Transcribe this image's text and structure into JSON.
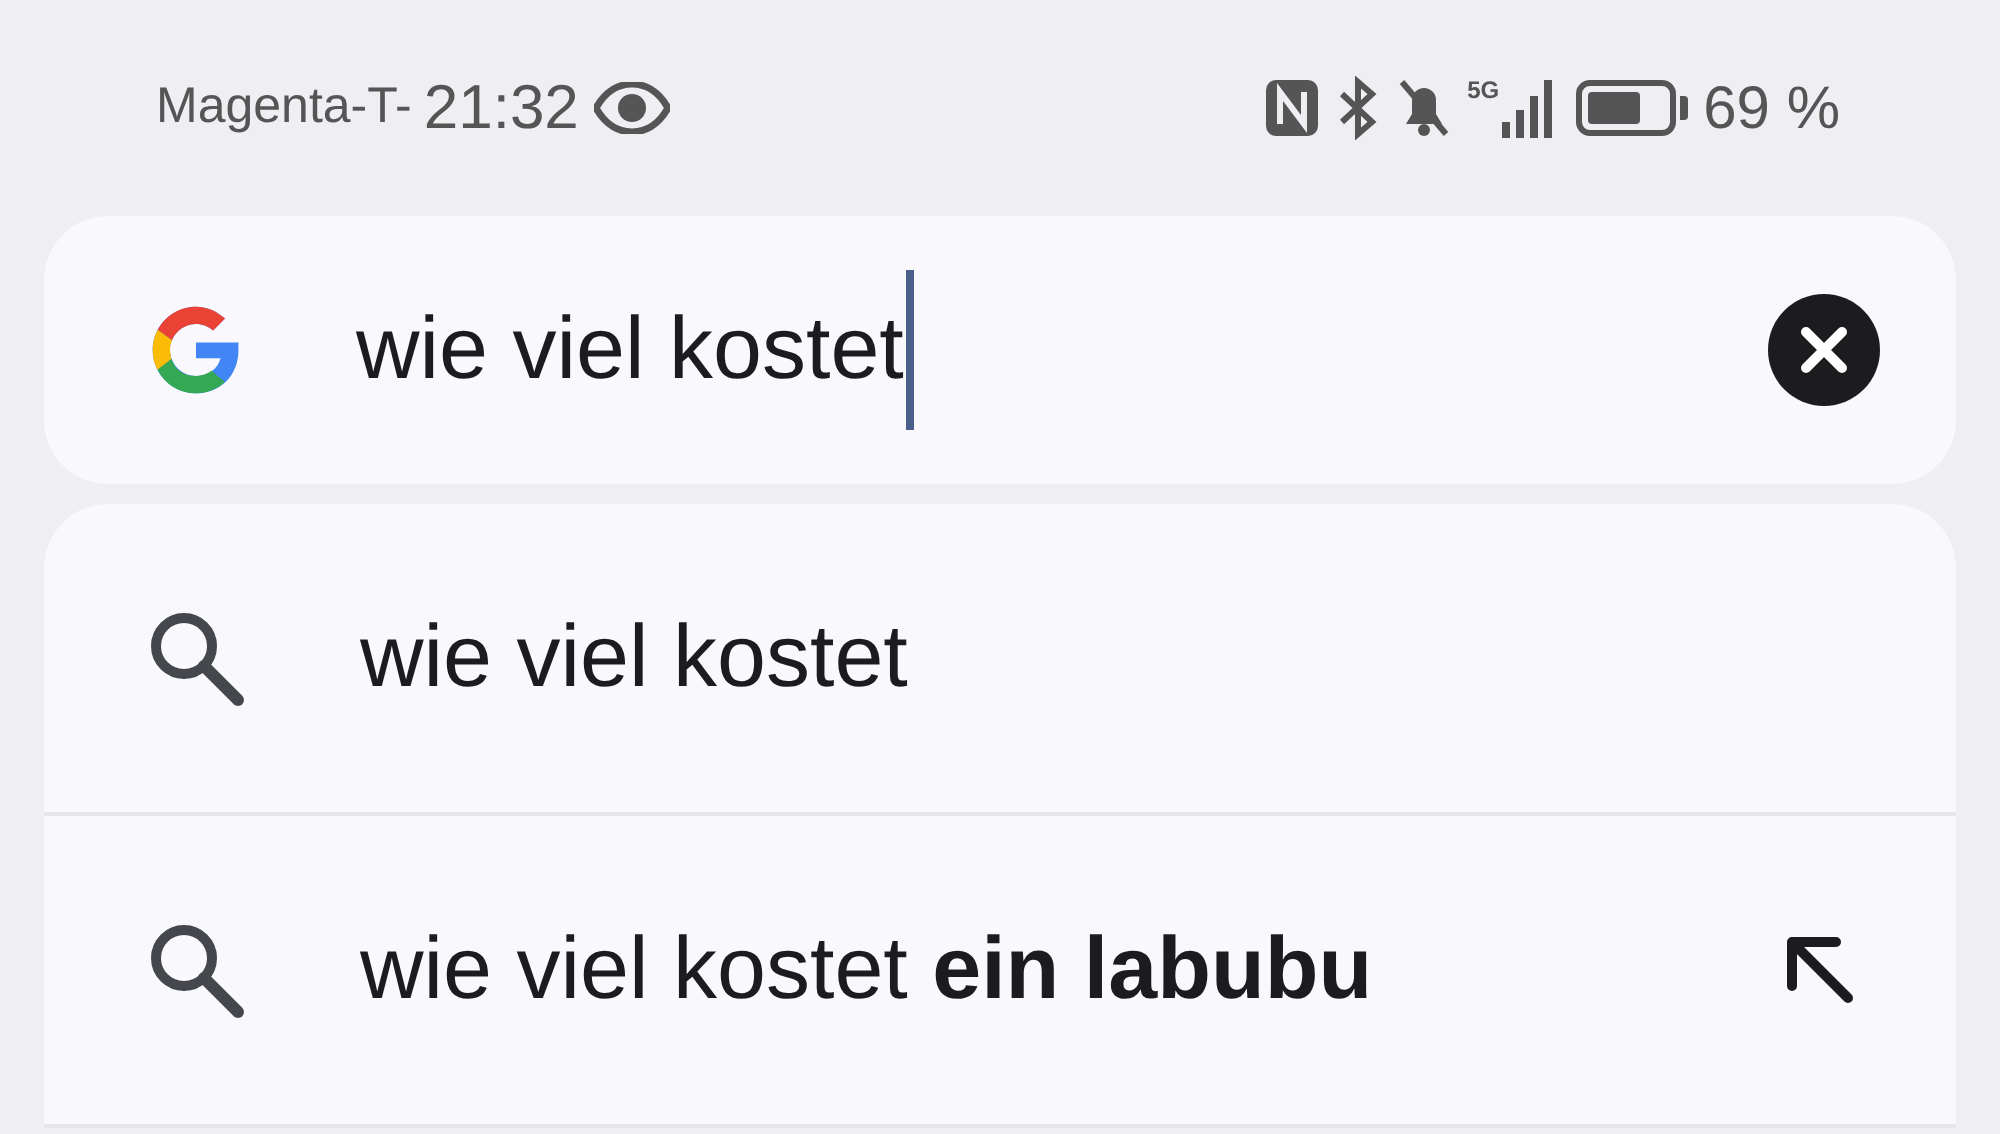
{
  "status_bar": {
    "carrier": "Magenta-T-",
    "time": "21:32",
    "network": "5G",
    "battery_text": "69 %"
  },
  "search": {
    "value": "wie viel kostet"
  },
  "suggestions": [
    {
      "text": "wie viel kostet",
      "fill_arrow": false
    },
    {
      "text": "wie viel kostet **ein labubu**",
      "fill_arrow": true
    }
  ]
}
